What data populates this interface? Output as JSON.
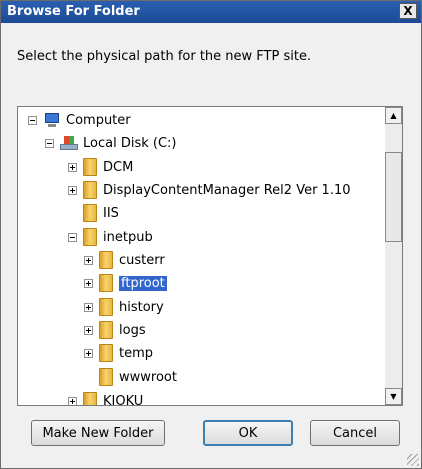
{
  "window": {
    "title": "Browse For Folder",
    "close_label": "X"
  },
  "prompt": "Select the physical path for the new FTP site.",
  "tree": {
    "computer": "Computer",
    "local_disk": "Local Disk (C:)",
    "dcm": "DCM",
    "dcm_rel2": "DisplayContentManager Rel2 Ver 1.10",
    "iis": "IIS",
    "inetpub": "inetpub",
    "custerr": "custerr",
    "ftproot": "ftproot",
    "history": "history",
    "logs": "logs",
    "temp": "temp",
    "wwwroot": "wwwroot",
    "kioku": "KIOKU"
  },
  "selected_item": "ftproot",
  "buttons": {
    "new_folder": "Make New Folder",
    "ok": "OK",
    "cancel": "Cancel"
  },
  "colors": {
    "titlebar": "#1c4a96",
    "selection": "#3366cc"
  },
  "icons": [
    "computer-icon",
    "local-disk-icon",
    "folder-icon",
    "scroll-up-icon",
    "scroll-down-icon"
  ]
}
